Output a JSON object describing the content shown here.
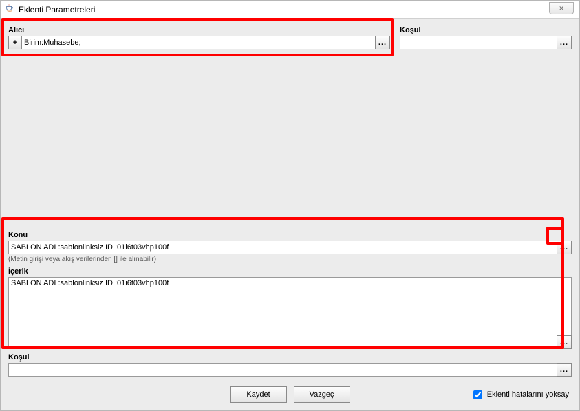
{
  "window": {
    "title": "Eklenti Parametreleri"
  },
  "alici": {
    "label": "Alıcı",
    "value": "Birim:Muhasebe;"
  },
  "kosul_top": {
    "label": "Koşul",
    "value": ""
  },
  "konu": {
    "label": "Konu",
    "value": "SABLON ADI :sablonlinksiz ID :01i6t03vhp100f",
    "hint": "(Metin girişi veya akış verilerinden [] ile alınabilir)"
  },
  "icerik": {
    "label": "İçerik",
    "value": "SABLON ADI :sablonlinksiz ID :01i6t03vhp100f"
  },
  "kosul_bottom": {
    "label": "Koşul",
    "value": ""
  },
  "buttons": {
    "save": "Kaydet",
    "cancel": "Vazgeç"
  },
  "checkbox": {
    "label": "Eklenti hatalarını yoksay",
    "checked": true
  },
  "icons": {
    "plus": "+",
    "dots": "...",
    "close": "✕"
  }
}
